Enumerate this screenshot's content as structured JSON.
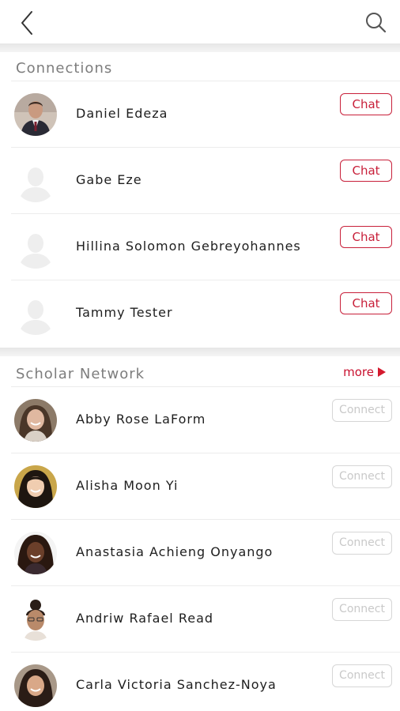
{
  "header": {
    "back_icon": "chevron-left-icon",
    "search_icon": "search-icon"
  },
  "connections": {
    "title": "Connections",
    "items": [
      {
        "name": "Daniel Edeza",
        "action": "Chat",
        "avatar": "photo"
      },
      {
        "name": "Gabe Eze",
        "action": "Chat",
        "avatar": "placeholder"
      },
      {
        "name": "Hillina Solomon Gebreyohannes",
        "action": "Chat",
        "avatar": "placeholder"
      },
      {
        "name": "Tammy Tester",
        "action": "Chat",
        "avatar": "placeholder"
      }
    ]
  },
  "scholar_network": {
    "title": "Scholar Network",
    "more_label": "more",
    "items": [
      {
        "name": "Abby Rose LaForm",
        "action": "Connect"
      },
      {
        "name": "Alisha Moon Yi",
        "action": "Connect"
      },
      {
        "name": "Anastasia Achieng Onyango",
        "action": "Connect"
      },
      {
        "name": "Andriw Rafael Read",
        "action": "Connect"
      },
      {
        "name": "Carla Victoria Sanchez-Noya",
        "action": "Connect"
      }
    ]
  },
  "colors": {
    "accent": "#c8203a",
    "section_title": "#7d7d7d",
    "disabled_button": "#c9c9c9"
  }
}
